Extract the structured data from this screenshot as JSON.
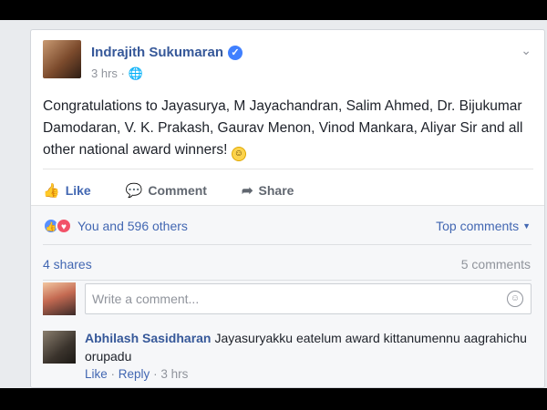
{
  "post": {
    "author": "Indrajith Sukumaran",
    "time": "3 hrs",
    "privacy_icon": "globe-icon",
    "text": "Congratulations to Jayasurya, M Jayachandran, Salim Ahmed, Dr. Bijukumar Damodaran, V. K. Prakash, Gaurav Menon, Vinod Mankara, Aliyar Sir and all other national award winners!",
    "emoji": "slightly-smiling-face"
  },
  "actions": {
    "like": "Like",
    "comment": "Comment",
    "share": "Share"
  },
  "feedback": {
    "reactions_text": "You and 596 others",
    "top_comments": "Top comments",
    "shares": "4 shares",
    "comments": "5 comments",
    "comment_placeholder": "Write a comment..."
  },
  "comment": {
    "author": "Abhilash Sasidharan",
    "text": "Jayasuryakku eatelum award kittanumennu aagrahichu orupadu",
    "like": "Like",
    "reply": "Reply",
    "time": "3 hrs"
  },
  "colors": {
    "link": "#365899",
    "accent": "#4267b2",
    "muted": "#90949c"
  }
}
